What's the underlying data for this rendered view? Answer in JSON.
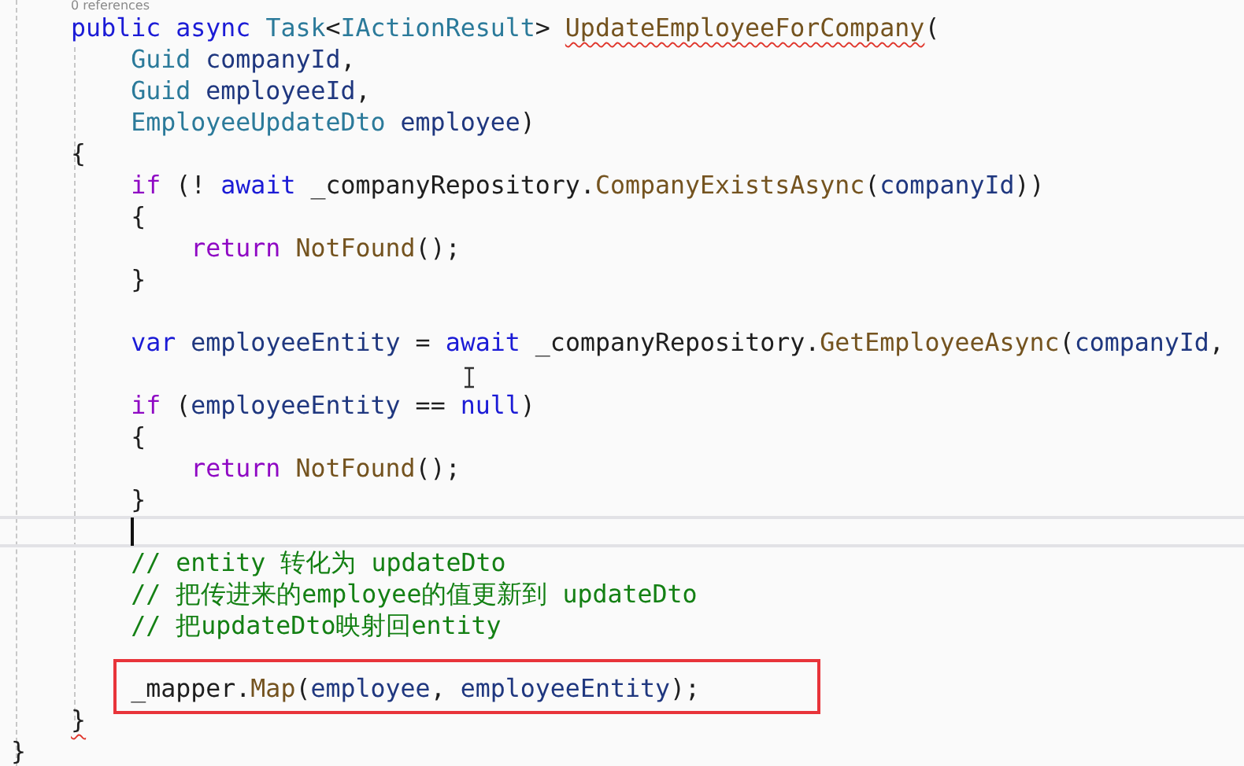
{
  "codelens": "0 references",
  "lines": [
    {
      "tokens": [
        {
          "text": "    public async ",
          "kind": "keyword"
        },
        {
          "text": "Task",
          "kind": "type"
        },
        {
          "text": "<",
          "kind": "plain"
        },
        {
          "text": "IActionResult",
          "kind": "type"
        },
        {
          "text": "> ",
          "kind": "plain"
        },
        {
          "text": "UpdateEmployeeForCompany",
          "kind": "method",
          "error": true
        },
        {
          "text": "(",
          "kind": "plain"
        }
      ]
    },
    {
      "tokens": [
        {
          "text": "        Guid ",
          "kind": "type"
        },
        {
          "text": "companyId",
          "kind": "local"
        },
        {
          "text": ",",
          "kind": "plain"
        }
      ]
    },
    {
      "tokens": [
        {
          "text": "        Guid ",
          "kind": "type"
        },
        {
          "text": "employeeId",
          "kind": "local"
        },
        {
          "text": ",",
          "kind": "plain"
        }
      ]
    },
    {
      "tokens": [
        {
          "text": "        EmployeeUpdateDto ",
          "kind": "type"
        },
        {
          "text": "employee",
          "kind": "local"
        },
        {
          "text": ")",
          "kind": "plain"
        }
      ]
    },
    {
      "tokens": [
        {
          "text": "    {",
          "kind": "plain"
        }
      ]
    },
    {
      "tokens": [
        {
          "text": "        if",
          "kind": "control"
        },
        {
          "text": " (! ",
          "kind": "plain"
        },
        {
          "text": "await",
          "kind": "keyword"
        },
        {
          "text": " _companyRepository.",
          "kind": "plain"
        },
        {
          "text": "CompanyExistsAsync",
          "kind": "method"
        },
        {
          "text": "(",
          "kind": "plain"
        },
        {
          "text": "companyId",
          "kind": "local"
        },
        {
          "text": "))",
          "kind": "plain"
        }
      ]
    },
    {
      "tokens": [
        {
          "text": "        {",
          "kind": "plain"
        }
      ]
    },
    {
      "tokens": [
        {
          "text": "            return ",
          "kind": "control"
        },
        {
          "text": "NotFound",
          "kind": "method"
        },
        {
          "text": "();",
          "kind": "plain"
        }
      ]
    },
    {
      "tokens": [
        {
          "text": "        }",
          "kind": "plain"
        }
      ]
    },
    {
      "kind": "blank"
    },
    {
      "tokens": [
        {
          "text": "        var ",
          "kind": "keyword"
        },
        {
          "text": "employeeEntity",
          "kind": "local"
        },
        {
          "text": " = ",
          "kind": "plain"
        },
        {
          "text": "await",
          "kind": "keyword"
        },
        {
          "text": " _companyRepository.",
          "kind": "plain"
        },
        {
          "text": "GetEmployeeAsync",
          "kind": "method"
        },
        {
          "text": "(",
          "kind": "plain"
        },
        {
          "text": "companyId",
          "kind": "local"
        },
        {
          "text": ",",
          "kind": "plain"
        }
      ]
    },
    {
      "kind": "blank"
    },
    {
      "tokens": [
        {
          "text": "        if",
          "kind": "control"
        },
        {
          "text": " (",
          "kind": "plain"
        },
        {
          "text": "employeeEntity",
          "kind": "local"
        },
        {
          "text": " == ",
          "kind": "plain"
        },
        {
          "text": "null",
          "kind": "keyword"
        },
        {
          "text": ")",
          "kind": "plain"
        }
      ]
    },
    {
      "tokens": [
        {
          "text": "        {",
          "kind": "plain"
        }
      ]
    },
    {
      "tokens": [
        {
          "text": "            return ",
          "kind": "control"
        },
        {
          "text": "NotFound",
          "kind": "method"
        },
        {
          "text": "();",
          "kind": "plain"
        }
      ]
    },
    {
      "tokens": [
        {
          "text": "        }",
          "kind": "plain"
        }
      ]
    },
    {
      "current": true
    },
    {
      "tokens": [
        {
          "text": "        // entity 转化为 updateDto",
          "kind": "comment"
        }
      ]
    },
    {
      "tokens": [
        {
          "text": "        // 把传进来的employee的值更新到 updateDto",
          "kind": "comment"
        }
      ]
    },
    {
      "tokens": [
        {
          "text": "        // 把updateDto映射回entity",
          "kind": "comment"
        }
      ]
    },
    {
      "kind": "blank"
    },
    {
      "boxed": true,
      "tokens": [
        {
          "text": "        _mapper.",
          "kind": "plain"
        },
        {
          "text": "Map",
          "kind": "method"
        },
        {
          "text": "(",
          "kind": "plain"
        },
        {
          "text": "employee",
          "kind": "local"
        },
        {
          "text": ", ",
          "kind": "plain"
        },
        {
          "text": "employeeEntity",
          "kind": "local"
        },
        {
          "text": ");",
          "kind": "plain"
        }
      ]
    },
    {
      "tokens": [
        {
          "text": "    }",
          "kind": "plain",
          "error": true
        }
      ]
    },
    {
      "tokens": [
        {
          "text": "}",
          "kind": "plain"
        }
      ]
    }
  ]
}
